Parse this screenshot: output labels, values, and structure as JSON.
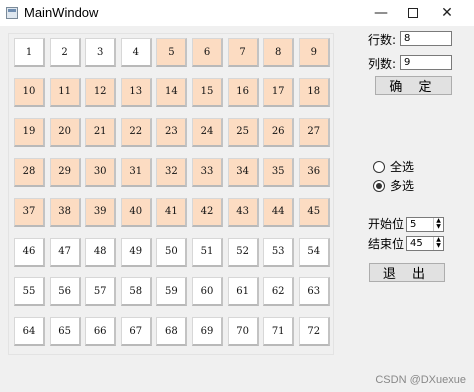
{
  "window": {
    "title": "MainWindow",
    "icon": "app-window-icon",
    "controls": {
      "minimize": "—",
      "close": "✕"
    }
  },
  "grid": {
    "rows": 8,
    "cols": 9,
    "cells": [
      {
        "n": "1",
        "on": false
      },
      {
        "n": "2",
        "on": false
      },
      {
        "n": "3",
        "on": false
      },
      {
        "n": "4",
        "on": false
      },
      {
        "n": "5",
        "on": true
      },
      {
        "n": "6",
        "on": true
      },
      {
        "n": "7",
        "on": true
      },
      {
        "n": "8",
        "on": true
      },
      {
        "n": "9",
        "on": true
      },
      {
        "n": "10",
        "on": true
      },
      {
        "n": "11",
        "on": true
      },
      {
        "n": "12",
        "on": true
      },
      {
        "n": "13",
        "on": true
      },
      {
        "n": "14",
        "on": true
      },
      {
        "n": "15",
        "on": true
      },
      {
        "n": "16",
        "on": true
      },
      {
        "n": "17",
        "on": true
      },
      {
        "n": "18",
        "on": true
      },
      {
        "n": "19",
        "on": true
      },
      {
        "n": "20",
        "on": true
      },
      {
        "n": "21",
        "on": true
      },
      {
        "n": "22",
        "on": true
      },
      {
        "n": "23",
        "on": true
      },
      {
        "n": "24",
        "on": true
      },
      {
        "n": "25",
        "on": true
      },
      {
        "n": "26",
        "on": true
      },
      {
        "n": "27",
        "on": true
      },
      {
        "n": "28",
        "on": true
      },
      {
        "n": "29",
        "on": true
      },
      {
        "n": "30",
        "on": true
      },
      {
        "n": "31",
        "on": true
      },
      {
        "n": "32",
        "on": true
      },
      {
        "n": "33",
        "on": true
      },
      {
        "n": "34",
        "on": true
      },
      {
        "n": "35",
        "on": true
      },
      {
        "n": "36",
        "on": true
      },
      {
        "n": "37",
        "on": true
      },
      {
        "n": "38",
        "on": true
      },
      {
        "n": "39",
        "on": true
      },
      {
        "n": "40",
        "on": true
      },
      {
        "n": "41",
        "on": true
      },
      {
        "n": "42",
        "on": true
      },
      {
        "n": "43",
        "on": true
      },
      {
        "n": "44",
        "on": true
      },
      {
        "n": "45",
        "on": true
      },
      {
        "n": "46",
        "on": false
      },
      {
        "n": "47",
        "on": false
      },
      {
        "n": "48",
        "on": false
      },
      {
        "n": "49",
        "on": false
      },
      {
        "n": "50",
        "on": false
      },
      {
        "n": "51",
        "on": false
      },
      {
        "n": "52",
        "on": false
      },
      {
        "n": "53",
        "on": false
      },
      {
        "n": "54",
        "on": false
      },
      {
        "n": "55",
        "on": false
      },
      {
        "n": "56",
        "on": false
      },
      {
        "n": "57",
        "on": false
      },
      {
        "n": "58",
        "on": false
      },
      {
        "n": "59",
        "on": false
      },
      {
        "n": "60",
        "on": false
      },
      {
        "n": "61",
        "on": false
      },
      {
        "n": "62",
        "on": false
      },
      {
        "n": "63",
        "on": false
      },
      {
        "n": "64",
        "on": false
      },
      {
        "n": "65",
        "on": false
      },
      {
        "n": "66",
        "on": false
      },
      {
        "n": "67",
        "on": false
      },
      {
        "n": "68",
        "on": false
      },
      {
        "n": "69",
        "on": false
      },
      {
        "n": "70",
        "on": false
      },
      {
        "n": "71",
        "on": false
      },
      {
        "n": "72",
        "on": false
      }
    ]
  },
  "controls": {
    "rows_label": "行数:",
    "rows_value": "8",
    "cols_label": "列数:",
    "cols_value": "9",
    "confirm_button": "确 定",
    "select_all_label": "全选",
    "multi_select_label": "多选",
    "selected_mode": "multi",
    "start_label": "开始位",
    "start_value": "5",
    "end_label": "结束位",
    "end_value": "45",
    "exit_button": "退 出"
  },
  "colors": {
    "selected_cell": "#fcdcc2",
    "unselected_cell": "#ffffff",
    "window_bg": "#f0f0f0"
  },
  "watermark": "CSDN @DXuexue"
}
